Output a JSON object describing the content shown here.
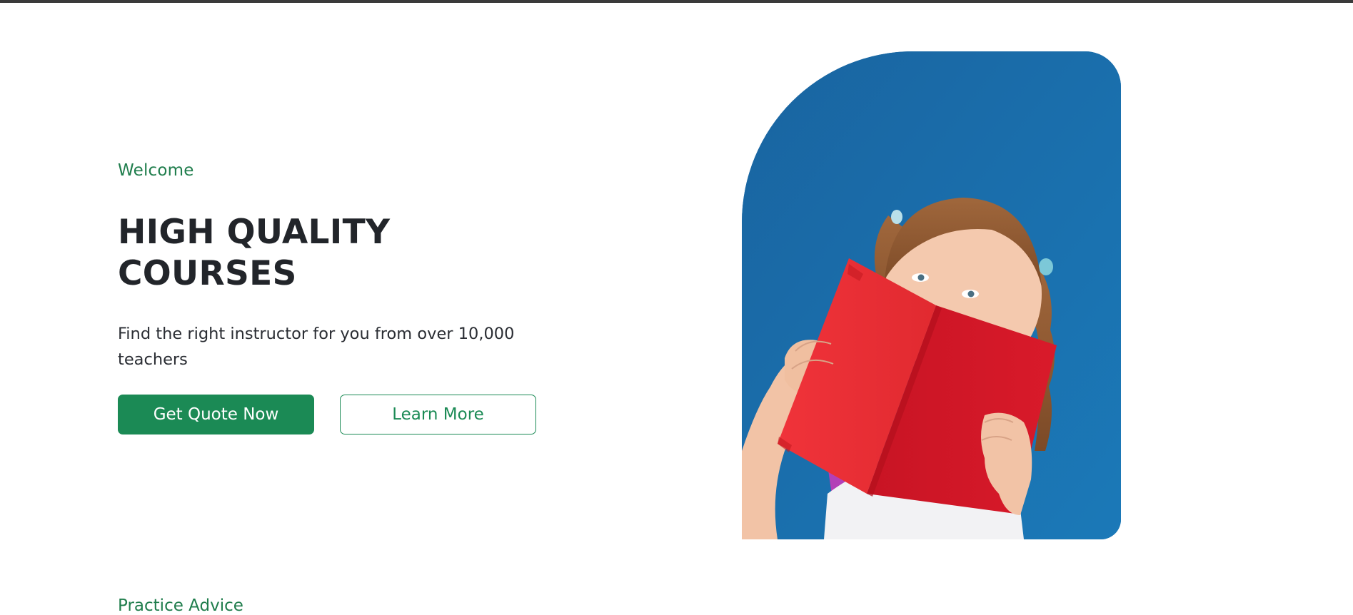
{
  "hero": {
    "eyebrow": "Welcome",
    "headline_line1": "HIGH QUALITY",
    "headline_line2": "COURSES",
    "subtext": "Find the right instructor for you from over 10,000 teachers",
    "primary_button": "Get Quote Now",
    "secondary_button": "Learn More",
    "image_subject": "girl-reading-red-book-photo"
  },
  "next_section": {
    "label": "Practice Advice"
  },
  "colors": {
    "accent_green": "#1b8a55",
    "eyebrow_green": "#1f7d4c",
    "heading_text": "#22252a",
    "photo_background": "#1b6aa6",
    "book_red": "#e8232b"
  }
}
